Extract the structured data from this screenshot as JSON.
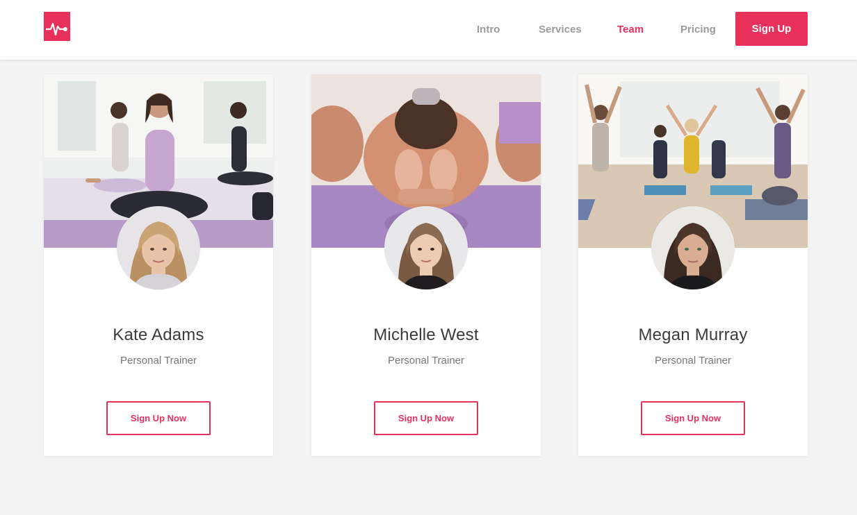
{
  "nav": {
    "links": [
      {
        "label": "Intro"
      },
      {
        "label": "Services"
      },
      {
        "label": "Team"
      },
      {
        "label": "Pricing"
      }
    ],
    "active": "Team",
    "signup_label": "Sign Up"
  },
  "team": [
    {
      "name": "Kate Adams",
      "role": "Personal Trainer",
      "button_label": "Sign Up Now"
    },
    {
      "name": "Michelle West",
      "role": "Personal Trainer",
      "button_label": "Sign Up Now"
    },
    {
      "name": "Megan Murray",
      "role": "Personal Trainer",
      "button_label": "Sign Up Now"
    }
  ],
  "colors": {
    "accent": "#e8305d",
    "background": "#f3f3f3",
    "nav_text": "#9a9a9a"
  },
  "icons": {
    "logo": "heartbeat-pulse-icon"
  }
}
